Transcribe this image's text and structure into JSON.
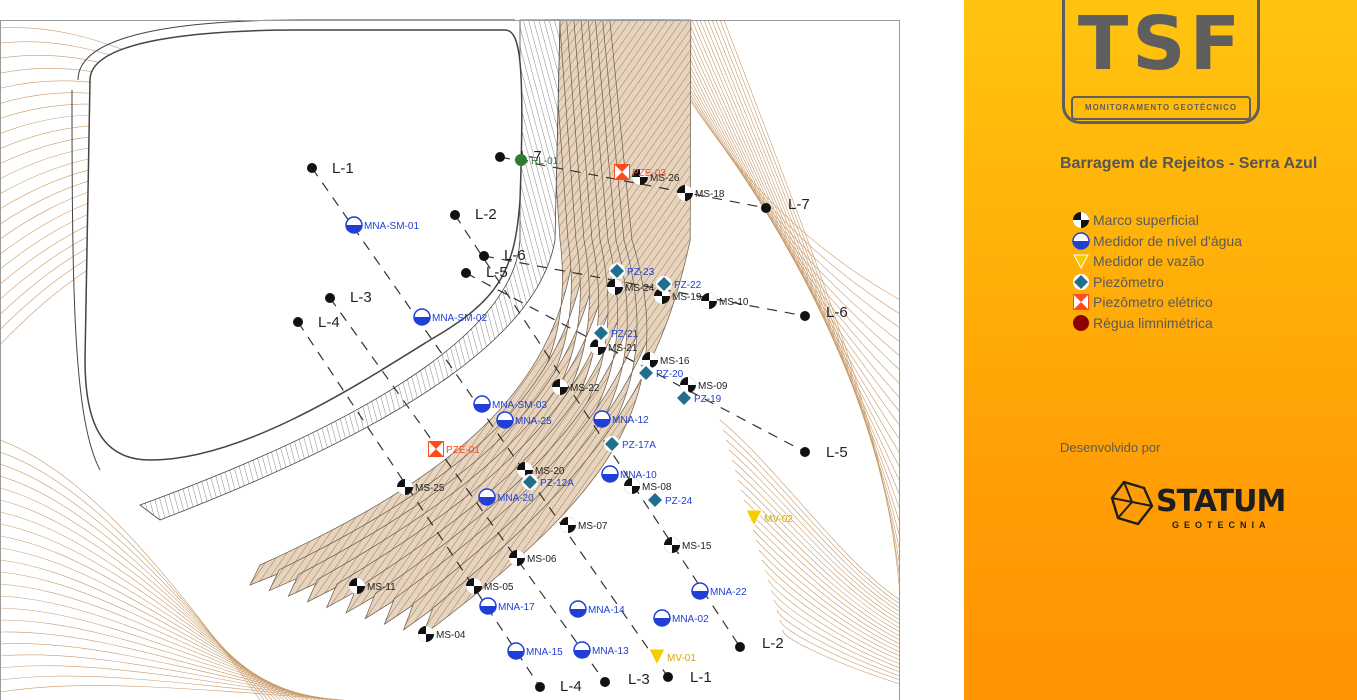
{
  "header": {
    "logo_text": "TSF",
    "logo_subtitle": "MONITORAMENTO GEOTÉCNICO",
    "dam_name": "Barragem de Rejeitos - Serra Azul"
  },
  "legend": [
    {
      "icon": "marco-superficial-icon",
      "label": "Marco superficial"
    },
    {
      "icon": "medidor-nivel-agua-icon",
      "label": "Medidor de nível d'água"
    },
    {
      "icon": "medidor-vazao-icon",
      "label": "Medidor de vazão"
    },
    {
      "icon": "piezometro-icon",
      "label": "Piezômetro"
    },
    {
      "icon": "piezometro-eletrico-icon",
      "label": "Piezômetro elétrico"
    },
    {
      "icon": "regua-limnimetrica-icon",
      "label": "Régua limnimétrica"
    }
  ],
  "footer": {
    "developed_by": "Desenvolvido por",
    "company": "STATUM",
    "company_sub": "GEOTECNIA"
  },
  "colors": {
    "panel_top": "#ffc40f",
    "panel_bottom": "#ff9400",
    "marker_black": "#111111",
    "marker_blue": "#1f3fd6",
    "marker_yellow": "#f5cc00",
    "marker_teal": "#1f6f8c",
    "marker_orange": "#ff4a1c",
    "marker_darkred": "#8b0000",
    "contour": "#c89a6a"
  },
  "map": {
    "sections": [
      {
        "id": "L-1",
        "label": "L-1"
      },
      {
        "id": "L-2",
        "label": "L-2"
      },
      {
        "id": "L-3",
        "label": "L-3"
      },
      {
        "id": "L-4",
        "label": "L-4"
      },
      {
        "id": "L-5",
        "label": "L-5"
      },
      {
        "id": "L-6",
        "label": "L-6"
      },
      {
        "id": "L-7",
        "label": "L-7"
      }
    ],
    "instruments": [
      {
        "type": "ms",
        "label": "MS-26"
      },
      {
        "type": "ms",
        "label": "MS-18"
      },
      {
        "type": "ms",
        "label": "MS-24"
      },
      {
        "type": "ms",
        "label": "MS-19"
      },
      {
        "type": "ms",
        "label": "MS-10"
      },
      {
        "type": "ms",
        "label": "MS-21"
      },
      {
        "type": "ms",
        "label": "MS-16"
      },
      {
        "type": "ms",
        "label": "MS-22"
      },
      {
        "type": "ms",
        "label": "MS-09"
      },
      {
        "type": "ms",
        "label": "MS-20"
      },
      {
        "type": "ms",
        "label": "MS-08"
      },
      {
        "type": "ms",
        "label": "MS-07"
      },
      {
        "type": "ms",
        "label": "MS-15"
      },
      {
        "type": "ms",
        "label": "MS-06"
      },
      {
        "type": "ms",
        "label": "MS-11"
      },
      {
        "type": "ms",
        "label": "MS-05"
      },
      {
        "type": "ms",
        "label": "MS-04"
      },
      {
        "type": "ms",
        "label": "MS-25"
      },
      {
        "type": "mna",
        "label": "MNA-SM-01"
      },
      {
        "type": "mna",
        "label": "MNA-SM-02"
      },
      {
        "type": "mna",
        "label": "MNA-SM-03"
      },
      {
        "type": "mna",
        "label": "MNA-25"
      },
      {
        "type": "mna",
        "label": "MNA-12"
      },
      {
        "type": "mna",
        "label": "MNA-10"
      },
      {
        "type": "mna",
        "label": "MNA-20"
      },
      {
        "type": "mna",
        "label": "MNA-13"
      },
      {
        "type": "mna",
        "label": "MNA-22"
      },
      {
        "type": "mna",
        "label": "MNA-17"
      },
      {
        "type": "mna",
        "label": "MNA-14"
      },
      {
        "type": "mna",
        "label": "MNA-02"
      },
      {
        "type": "mna",
        "label": "MNA-15"
      },
      {
        "type": "mv",
        "label": "MV-01"
      },
      {
        "type": "mv",
        "label": "MV-02"
      },
      {
        "type": "pz",
        "label": "PZ-23"
      },
      {
        "type": "pz",
        "label": "PZ-22"
      },
      {
        "type": "pz",
        "label": "PZ-21"
      },
      {
        "type": "pz",
        "label": "PZ-20"
      },
      {
        "type": "pz",
        "label": "PZ-19"
      },
      {
        "type": "pz",
        "label": "PZ-17A"
      },
      {
        "type": "pz",
        "label": "PZ-12A"
      },
      {
        "type": "pz",
        "label": "PZ-24"
      },
      {
        "type": "pze",
        "label": "PZE-03"
      },
      {
        "type": "pze",
        "label": "PZE-01"
      },
      {
        "type": "rl",
        "label": "RL-01"
      }
    ]
  }
}
